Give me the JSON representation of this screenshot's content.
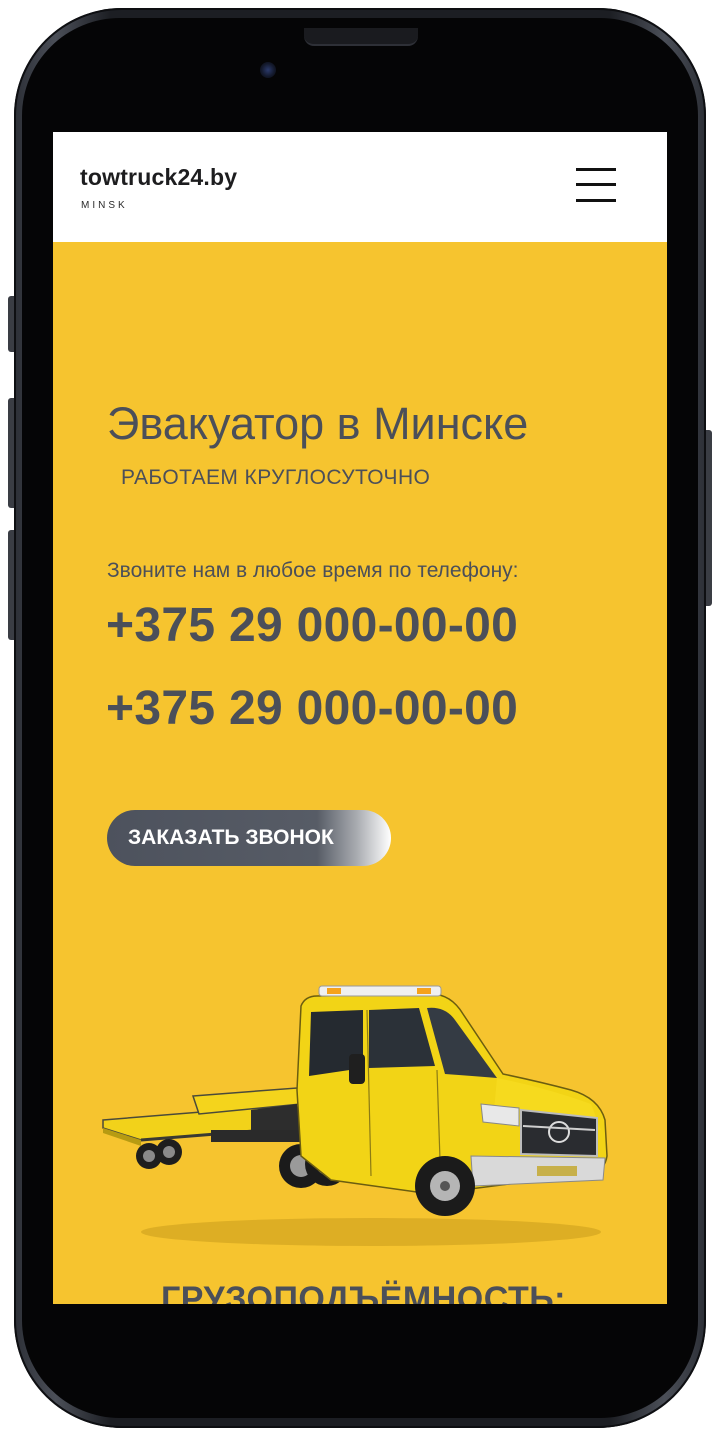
{
  "brand": {
    "title": "towtruck24.by",
    "subtitle": "MINSK"
  },
  "hero": {
    "title": "Эвакуатор в Минске",
    "subtitle": "РАБОТАЕМ КРУГЛОСУТОЧНО",
    "call_caption": "Звоните нам в любое время по телефону:",
    "phones": [
      "+375 29 000-00-00",
      "+375 29 000-00-00"
    ],
    "cta_label": "ЗАКАЗАТЬ ЗВОНОК"
  },
  "next_section": {
    "heading": "ГРУЗОПОДЪЁМНОСТЬ:"
  },
  "colors": {
    "hero_background": "#f6c42f",
    "text_dark": "#4b4f59",
    "button": "#4d525d",
    "header_background": "#ffffff"
  },
  "icons": {
    "menu": "hamburger-menu-icon",
    "truck": "tow-truck-illustration"
  }
}
